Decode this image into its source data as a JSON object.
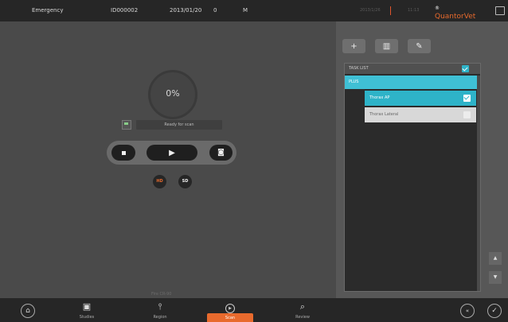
{
  "header": {
    "department": "Emergency",
    "patient_id": "ID000002",
    "birth_date": "2013/01/20",
    "age": "0",
    "sex": "M",
    "current_date": "2013/1/26",
    "time": "11:13",
    "brand": "QuantorVet",
    "brand_mark": "®",
    "icon": "export-icon"
  },
  "scan": {
    "progress": "0%",
    "status": "Ready for scan",
    "quality_hd": "HD",
    "quality_sd": "SD",
    "selected_quality": "HD",
    "controls": {
      "stop_glyph": "■",
      "play_glyph": "▶",
      "camera_glyph": "◙"
    },
    "firmware": "Fire CR-90"
  },
  "task_panel": {
    "toolbar": {
      "add_glyph": "+",
      "delete_glyph": "▥",
      "edit_glyph": "✎"
    },
    "header_label": "TASK LIST",
    "group_label": "PLUS",
    "items": [
      {
        "label": "Thorax AP",
        "checked": true
      },
      {
        "label": "Thorax Lateral",
        "checked": false
      }
    ],
    "scroll_up_glyph": "▲",
    "scroll_down_glyph": "▼"
  },
  "nav": {
    "home_glyph": "⌂",
    "items": [
      {
        "label": "Studies",
        "icon": "studies-icon",
        "glyph": "▣"
      },
      {
        "label": "Region",
        "icon": "region-icon",
        "glyph": "⫯"
      },
      {
        "label": "Scan",
        "icon": "scan-icon",
        "glyph": "▶"
      },
      {
        "label": "Review",
        "icon": "review-icon",
        "glyph": "⌕"
      }
    ],
    "active": "Scan",
    "back_glyph": "«",
    "confirm_glyph": "✓"
  },
  "colors": {
    "accent": "#e86a2d",
    "selection": "#2eb3c8"
  }
}
